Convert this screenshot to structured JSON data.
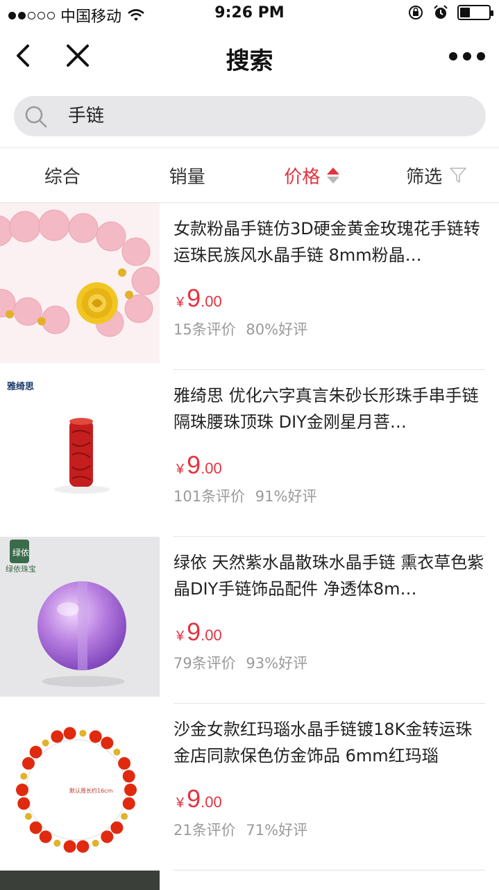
{
  "status_bar": {
    "carrier": "中国移动",
    "time": "9:26 PM",
    "signal_filled": 2,
    "signal_total": 5,
    "battery_level": 0.35
  },
  "nav": {
    "title": "搜索",
    "back_icon": "chevron-left-icon",
    "close_icon": "close-icon",
    "more_icon": "more-dots-icon"
  },
  "search": {
    "value": "手链",
    "icon": "search-icon"
  },
  "sort_tabs": [
    {
      "label": "综合",
      "active": false
    },
    {
      "label": "销量",
      "active": false
    },
    {
      "label": "价格",
      "active": true
    },
    {
      "label": "筛选",
      "active": false
    }
  ],
  "colors": {
    "accent": "#e2333f",
    "muted": "#9a9a9a",
    "search_bg": "#e7e7e9"
  },
  "products": [
    {
      "title": "女款粉晶手链仿3D硬金黄金玫瑰花手链转运珠民族风水晶手链 8mm粉晶…",
      "price_currency": "¥",
      "price_int": "9",
      "price_dec": ".00",
      "reviews": "15条评价",
      "positive": "80%好评"
    },
    {
      "title": "雅绮思 优化六字真言朱砂长形珠手串手链隔珠腰珠顶珠 DIY金刚星月菩…",
      "price_currency": "¥",
      "price_int": "9",
      "price_dec": ".00",
      "reviews": "101条评价",
      "positive": "91%好评"
    },
    {
      "title": "绿依 天然紫水晶散珠水晶手链 熏衣草色紫晶DIY手链饰品配件 净透体8m…",
      "price_currency": "¥",
      "price_int": "9",
      "price_dec": ".00",
      "reviews": "79条评价",
      "positive": "93%好评"
    },
    {
      "title": "沙金女款红玛瑙水晶手链镀18K金转运珠金店同款保色仿金饰品 6mm红玛瑙",
      "price_currency": "¥",
      "price_int": "9",
      "price_dec": ".00",
      "reviews": "21条评价",
      "positive": "71%好评"
    }
  ],
  "thumb_brands": {
    "p2": "雅绮思",
    "p3_logo": "绿依",
    "p3_name": "绿依珠宝",
    "p4_tag": "默认周长约16cm"
  }
}
